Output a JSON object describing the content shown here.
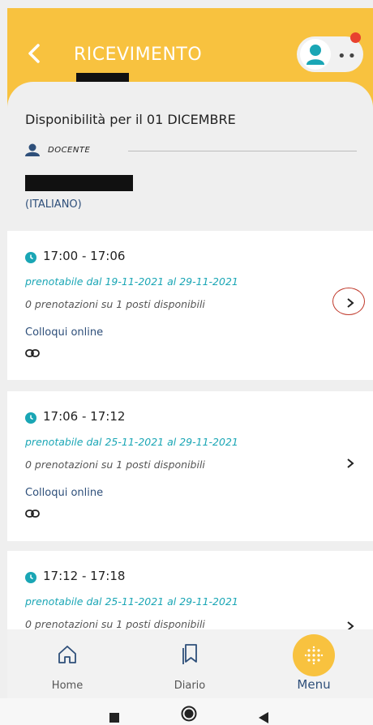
{
  "header": {
    "title": "RICEVIMENTO",
    "back_icon": "chevron-left-icon",
    "avatar_icon": "user-icon",
    "more_icon": "dots-icon",
    "accent_color": "#f8c23f",
    "notification_color": "#e8412f"
  },
  "summary": {
    "title": "Disponibilità per il 01 DICEMBRE",
    "role_label": "DOCENTE",
    "subject": "(ITALIANO)"
  },
  "slots": [
    {
      "time": "17:00 - 17:06",
      "booking": "prenotabile dal 19-11-2021 al 29-11-2021",
      "availability": "0 prenotazioni su 1 posti disponibili",
      "mode": "Colloqui online",
      "highlighted": true
    },
    {
      "time": "17:06 - 17:12",
      "booking": "prenotabile dal 25-11-2021 al 29-11-2021",
      "availability": "0 prenotazioni su 1 posti disponibili",
      "mode": "Colloqui online",
      "highlighted": false
    },
    {
      "time": "17:12 - 17:18",
      "booking": "prenotabile dal 25-11-2021 al 29-11-2021",
      "availability": "0 prenotazioni su 1 posti disponibili",
      "mode": "",
      "highlighted": false
    }
  ],
  "bottom_nav": {
    "home": "Home",
    "diario": "Diario",
    "menu": "Menu"
  },
  "system_nav": {
    "recent_icon": "square-icon",
    "home_icon": "circle-icon",
    "back_icon": "triangle-back-icon"
  }
}
